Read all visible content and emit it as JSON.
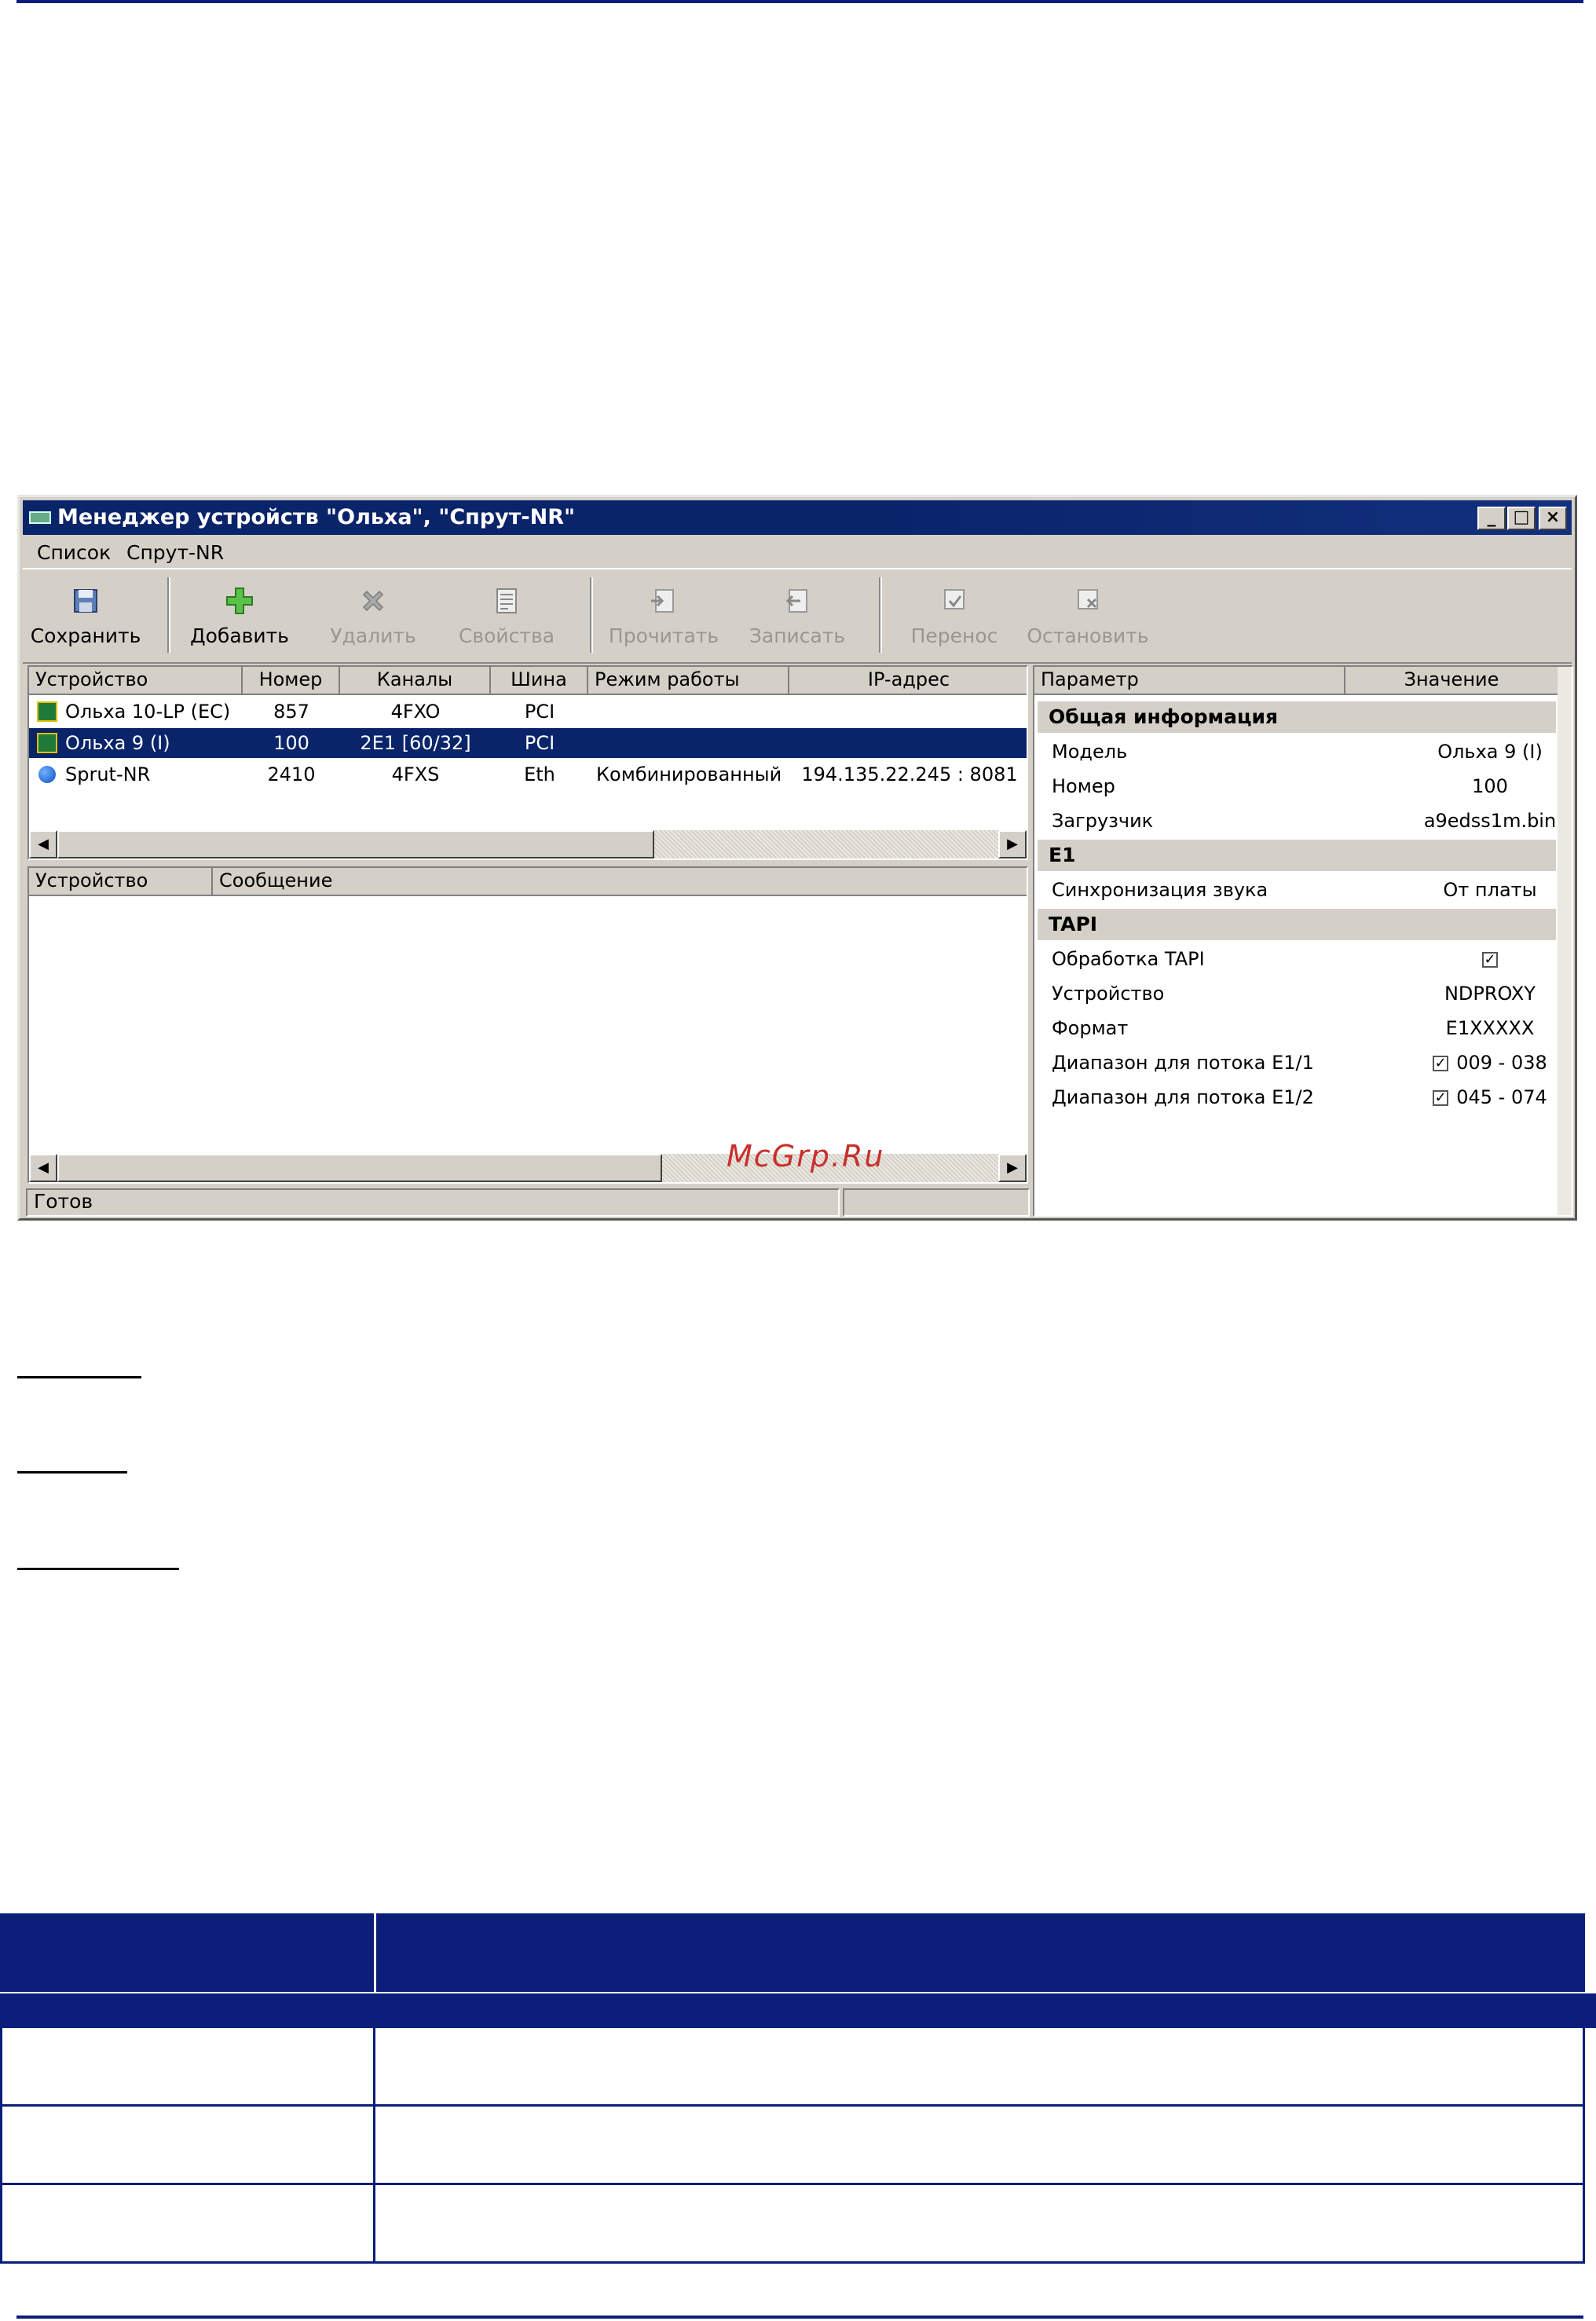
{
  "window": {
    "title": "Менеджер устройств \"Ольха\", \"Спрут-NR\"",
    "controls": {
      "minimize": "_",
      "maximize": "□",
      "close": "×"
    }
  },
  "menu": [
    "Список",
    "Спрут-NR"
  ],
  "toolbar": [
    {
      "label": "Сохранить",
      "icon": "save-icon",
      "enabled": true
    },
    {
      "label": "Добавить",
      "icon": "add-icon",
      "enabled": true
    },
    {
      "label": "Удалить",
      "icon": "delete-icon",
      "enabled": false
    },
    {
      "label": "Свойства",
      "icon": "properties-icon",
      "enabled": false
    },
    {
      "label": "Прочитать",
      "icon": "read-icon",
      "enabled": false
    },
    {
      "label": "Записать",
      "icon": "write-icon",
      "enabled": false
    },
    {
      "label": "Перенос",
      "icon": "transfer-icon",
      "enabled": false
    },
    {
      "label": "Остановить",
      "icon": "stop-icon",
      "enabled": false
    }
  ],
  "devices": {
    "columns": [
      "Устройство",
      "Номер",
      "Каналы",
      "Шина",
      "Режим работы",
      "IP-адрес"
    ],
    "rows": [
      {
        "name": "Ольха 10-LP (EC)",
        "number": "857",
        "channels": "4FXO",
        "bus": "PCI",
        "mode": "",
        "ip": "",
        "icon": "board-icon"
      },
      {
        "name": "Ольха 9 (I)",
        "number": "100",
        "channels": "2E1 [60/32]",
        "bus": "PCI",
        "mode": "",
        "ip": "",
        "icon": "board-icon",
        "selected": true
      },
      {
        "name": "Sprut-NR",
        "number": "2410",
        "channels": "4FXS",
        "bus": "Eth",
        "mode": "Комбинированный",
        "ip": "194.135.22.245 : 8081",
        "icon": "network-icon"
      }
    ]
  },
  "messages": {
    "columns": [
      "Устройство",
      "Сообщение"
    ]
  },
  "status": {
    "text": "Готов"
  },
  "properties": {
    "columns": [
      "Параметр",
      "Значение"
    ],
    "sections": [
      {
        "title": "Общая информация",
        "items": [
          {
            "name": "Модель",
            "value": "Ольха 9 (I)"
          },
          {
            "name": "Номер",
            "value": "100"
          },
          {
            "name": "Загрузчик",
            "value": "a9edss1m.bin"
          }
        ]
      },
      {
        "title": "E1",
        "items": [
          {
            "name": "Синхронизация звука",
            "value": "От платы"
          }
        ]
      },
      {
        "title": "TAPI",
        "items": [
          {
            "name": "Обработка TAPI",
            "value": "",
            "checked": true
          },
          {
            "name": "Устройство",
            "value": "NDPROXY"
          },
          {
            "name": "Формат",
            "value": "E1XXXXX"
          },
          {
            "name": "Диапазон для потока E1/1",
            "value": "009 - 038",
            "checked": true
          },
          {
            "name": "Диапазон для потока E1/2",
            "value": "045 - 074",
            "checked": true
          }
        ]
      }
    ]
  },
  "watermark": "McGrp.Ru",
  "colors": {
    "accent": "#0b1e7a",
    "selection": "#0a246a",
    "window_bg": "#d4d0c8"
  }
}
